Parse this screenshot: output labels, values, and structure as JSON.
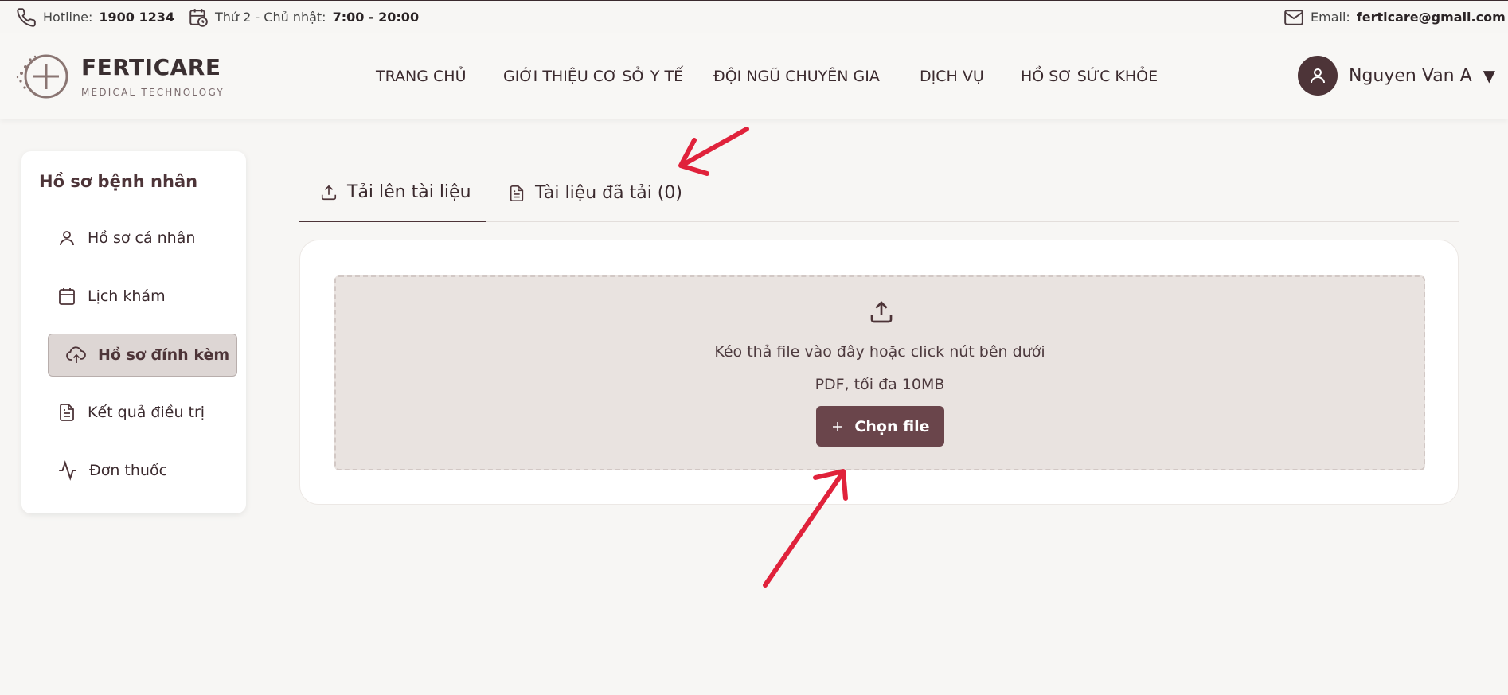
{
  "topbar": {
    "hotline_label": "Hotline:",
    "hotline_value": "1900 1234",
    "hours_label": "Thứ 2 - Chủ nhật:",
    "hours_value": "7:00 - 20:00",
    "email_label": "Email:",
    "email_value": "ferticare@gmail.com"
  },
  "brand": {
    "name": "FERTICARE",
    "tagline": "MEDICAL TECHNOLOGY"
  },
  "nav": {
    "items": [
      "TRANG CHỦ",
      "GIỚI THIỆU CƠ SỞ Y TẾ",
      "ĐỘI NGŨ CHUYÊN GIA",
      "DỊCH VỤ",
      "HỒ SƠ SỨC KHỎE"
    ]
  },
  "user": {
    "name": "Nguyen Van A",
    "caret": "▼"
  },
  "sidebar": {
    "title": "Hồ sơ bệnh nhân",
    "items": [
      {
        "label": "Hồ sơ cá nhân",
        "icon": "user-icon",
        "active": false
      },
      {
        "label": "Lịch khám",
        "icon": "calendar-icon",
        "active": false
      },
      {
        "label": "Hồ sơ đính kèm",
        "icon": "cloud-upload-icon",
        "active": true
      },
      {
        "label": "Kết quả điều trị",
        "icon": "document-icon",
        "active": false
      },
      {
        "label": "Đơn thuốc",
        "icon": "activity-icon",
        "active": false
      }
    ]
  },
  "tabs": [
    {
      "label": "Tải lên tài liệu",
      "icon": "upload-icon",
      "active": true
    },
    {
      "label": "Tài liệu đã tải (0)",
      "icon": "document-icon",
      "active": false
    }
  ],
  "upload": {
    "instruction": "Kéo thả file vào đây hoặc click nút bên dưới",
    "hint": "PDF, tối đa 10MB",
    "button_label": "Chọn file"
  },
  "colors": {
    "accent": "#6a454b",
    "annotation_arrow": "#e0223b",
    "dropzone_bg": "#e9e3e0",
    "active_item_bg": "#ddd6d4"
  }
}
